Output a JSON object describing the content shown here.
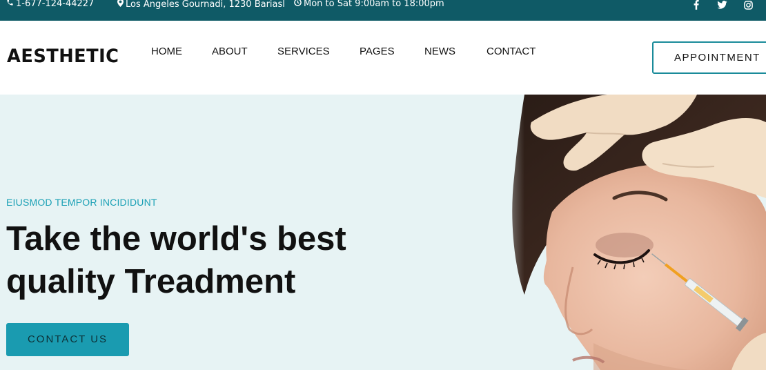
{
  "topbar": {
    "phone": "1-677-124-44227",
    "address": "Los Angeles Gournadi, 1230 Bariasl",
    "hours": "Mon to Sat 9:00am to 18:00pm",
    "social": [
      "facebook-icon",
      "twitter-icon",
      "instagram-icon"
    ],
    "background": "#0f5a66"
  },
  "header": {
    "logo": "AESTHETIC",
    "nav": [
      "HOME",
      "ABOUT",
      "SERVICES",
      "PAGES",
      "NEWS",
      "CONTACT"
    ],
    "appointment_label": "APPOINTMENT",
    "accent": "#1a8b9a"
  },
  "hero": {
    "subtitle": "EIUSMOD TEMPOR INCIDIDUNT",
    "headline_line1": "Take the world's best",
    "headline_line2": "quality Treadment",
    "contact_label": "CONTACT US",
    "background": "#e7f3f4",
    "accent": "#1a9bb0"
  }
}
